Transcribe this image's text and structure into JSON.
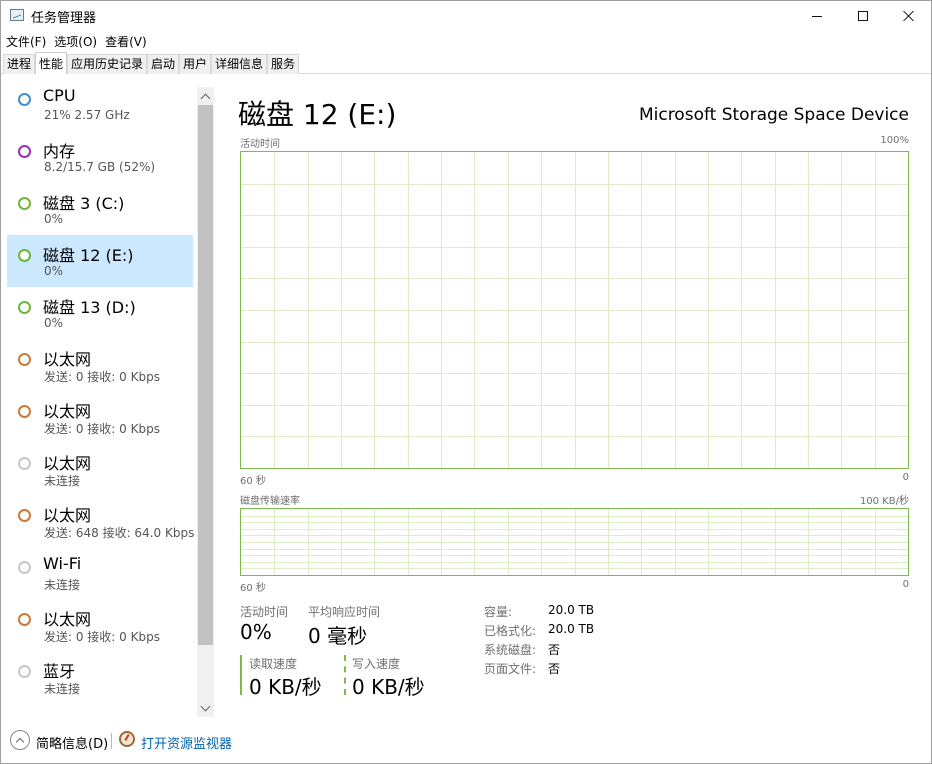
{
  "window": {
    "title": "任务管理器"
  },
  "menu": [
    "文件(F)",
    "选项(O)",
    "查看(V)"
  ],
  "tabs": [
    {
      "label": "进程",
      "active": false
    },
    {
      "label": "性能",
      "active": true
    },
    {
      "label": "应用历史记录",
      "active": false
    },
    {
      "label": "启动",
      "active": false
    },
    {
      "label": "用户",
      "active": false
    },
    {
      "label": "详细信息",
      "active": false
    },
    {
      "label": "服务",
      "active": false
    }
  ],
  "sidebar": {
    "items": [
      {
        "title": "CPU",
        "subtitle": "21%  2.57 GHz",
        "ring_color": "#3e8ed0",
        "selected": false
      },
      {
        "title": "内存",
        "subtitle": "8.2/15.7 GB (52%)",
        "ring_color": "#9b2eb8",
        "selected": false
      },
      {
        "title": "磁盘 3 (C:)",
        "subtitle": "0%",
        "ring_color": "#6ab73b",
        "selected": false
      },
      {
        "title": "磁盘 12 (E:)",
        "subtitle": "0%",
        "ring_color": "#6ab73b",
        "selected": true
      },
      {
        "title": "磁盘 13 (D:)",
        "subtitle": "0%",
        "ring_color": "#6ab73b",
        "selected": false
      },
      {
        "title": "以太网",
        "subtitle": "发送: 0 接收: 0 Kbps",
        "ring_color": "#c87a3a",
        "selected": false
      },
      {
        "title": "以太网",
        "subtitle": "发送: 0 接收: 0 Kbps",
        "ring_color": "#c87a3a",
        "selected": false
      },
      {
        "title": "以太网",
        "subtitle": "未连接",
        "ring_color": "#c8c8c8",
        "selected": false
      },
      {
        "title": "以太网",
        "subtitle": "发送: 648 接收: 64.0 Kbps",
        "ring_color": "#c87a3a",
        "selected": false
      },
      {
        "title": "Wi-Fi",
        "subtitle": "未连接",
        "ring_color": "#c8c8c8",
        "selected": false
      },
      {
        "title": "以太网",
        "subtitle": "发送: 0 接收: 0 Kbps",
        "ring_color": "#c87a3a",
        "selected": false
      },
      {
        "title": "蓝牙",
        "subtitle": "未连接",
        "ring_color": "#c8c8c8",
        "selected": false
      }
    ]
  },
  "main": {
    "title": "磁盘 12 (E:)",
    "device": "Microsoft Storage Space Device",
    "activity_chart": {
      "label": "活动时间",
      "max_label": "100%",
      "time_label": "60 秒",
      "min_label": "0"
    },
    "transfer_chart": {
      "label": "磁盘传输速率",
      "max_label": "100 KB/秒",
      "time_label": "60 秒",
      "min_label": "0"
    },
    "stats": {
      "active_time_label": "活动时间",
      "active_time_value": "0%",
      "avg_response_label": "平均响应时间",
      "avg_response_value": "0 毫秒",
      "read_label": "读取速度",
      "read_value": "0 KB/秒",
      "write_label": "写入速度",
      "write_value": "0 KB/秒"
    },
    "properties": [
      {
        "label": "容量:",
        "value": "20.0 TB"
      },
      {
        "label": "已格式化:",
        "value": "20.0 TB"
      },
      {
        "label": "系统磁盘:",
        "value": "否"
      },
      {
        "label": "页面文件:",
        "value": "否"
      }
    ]
  },
  "footer": {
    "summary_label": "简略信息(D)",
    "resource_monitor_label": "打开资源监视器"
  },
  "colors": {
    "chart_border": "#7fba4c",
    "grid_line": "#dcedc8",
    "selected_bg": "#cce8ff",
    "link": "#0063b1"
  }
}
